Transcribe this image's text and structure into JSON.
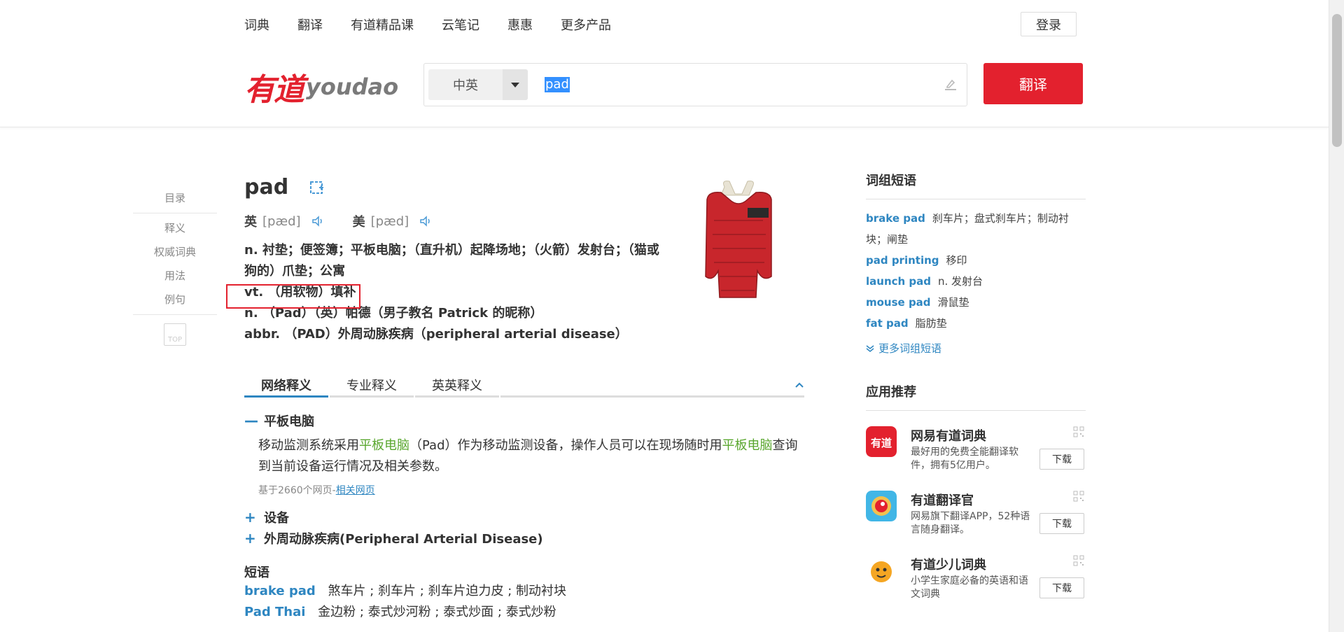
{
  "topnav": [
    "词典",
    "翻译",
    "有道精品课",
    "云笔记",
    "惠惠",
    "更多产品"
  ],
  "login": "登录",
  "logo": {
    "cn": "有道",
    "en": "youdao"
  },
  "search": {
    "lang": "中英",
    "query": "pad"
  },
  "translate_button": "翻译",
  "sidenav": {
    "catalog": "目录",
    "items": [
      "释义",
      "权威词典",
      "用法",
      "例句"
    ],
    "top": "TOP"
  },
  "entry": {
    "word": "pad",
    "uk_label": "英",
    "uk_phonetic": "[pæd]",
    "us_label": "美",
    "us_phonetic": "[pæd]",
    "translations": [
      "n. 衬垫；便签簿；平板电脑；（直升机）起降场地；（火箭）发射台；（猫或狗的）爪垫；公寓",
      "vt. （用软物）填补",
      "n. （Pad）（英）帕德（男子教名 Patrick 的昵称）",
      "abbr. （PAD）外周动脉疾病（peripheral arterial disease）"
    ]
  },
  "tabs": [
    "网络释义",
    "专业释义",
    "英英释义"
  ],
  "web_defs": {
    "first": {
      "title": "平板电脑",
      "body_pre": "移动监测系统采用",
      "hl1": "平板电脑",
      "body_mid": "（Pad）作为移动监测设备，操作人员可以在现场随时用",
      "hl2": "平板电脑",
      "body_post": "查询到当前设备运行情况及相关参数。",
      "source_pre": "基于2660个网页-",
      "source_link": "相关网页"
    },
    "others": [
      "设备",
      "外周动脉疾病(Peripheral Arterial Disease)"
    ]
  },
  "phrases": {
    "title": "短语",
    "rows": [
      {
        "en": "brake pad",
        "cn": "煞车片 ; 刹车片 ; 刹车片迫力皮 ; 制动衬块"
      },
      {
        "en": "Pad Thai",
        "cn": "金边粉 ; 泰式炒河粉 ; 泰式炒面 ; 泰式炒粉"
      }
    ]
  },
  "sidebar": {
    "groups_title": "词组短语",
    "groups": [
      {
        "en": "brake pad",
        "cn": "刹车片；盘式刹车片；制动衬块；闸垫"
      },
      {
        "en": "pad printing",
        "cn": "移印"
      },
      {
        "en": "launch pad",
        "cn": "n. 发射台"
      },
      {
        "en": "mouse pad",
        "cn": "滑鼠垫"
      },
      {
        "en": "fat pad",
        "cn": "脂肪垫"
      }
    ],
    "more": "更多词组短语",
    "apps_title": "应用推荐",
    "apps": [
      {
        "name": "网易有道词典",
        "desc": "最好用的免费全能翻译软件，拥有5亿用户。",
        "button": "下载"
      },
      {
        "name": "有道翻译官",
        "desc": "网易旗下翻译APP，52种语言随身翻译。",
        "button": "下载"
      },
      {
        "name": "有道少儿词典",
        "desc": "小学生家庭必备的英语和语文词典",
        "button": "下载"
      }
    ]
  },
  "colors": {
    "brand_red": "#e3212e",
    "link_blue": "#2e86c1",
    "highlight_green": "#5aa72f"
  }
}
